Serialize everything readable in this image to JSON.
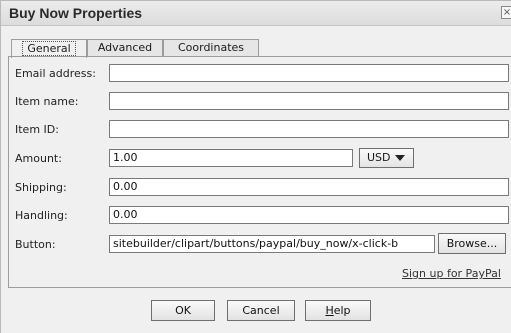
{
  "window": {
    "title": "Buy Now Properties",
    "close_glyph": "×"
  },
  "tabs": [
    {
      "label": "General",
      "active": true
    },
    {
      "label": "Advanced",
      "active": false
    },
    {
      "label": "Coordinates",
      "active": false
    }
  ],
  "form": {
    "email": {
      "label": "Email address:",
      "value": ""
    },
    "item_name": {
      "label": "Item name:",
      "value": ""
    },
    "item_id": {
      "label": "Item ID:",
      "value": ""
    },
    "amount": {
      "label": "Amount:",
      "value": "1.00",
      "currency": "USD"
    },
    "shipping": {
      "label": "Shipping:",
      "value": "0.00"
    },
    "handling": {
      "label": "Handling:",
      "value": "0.00"
    },
    "button": {
      "label": "Button:",
      "value": "sitebuilder/clipart/buttons/paypal/buy_now/x-click-b",
      "browse_label": "Browse..."
    }
  },
  "signup_link": "Sign up for PayPal",
  "footer": {
    "ok_label": "OK",
    "cancel_label": "Cancel",
    "help_mnemonic": "H",
    "help_rest": "elp"
  }
}
